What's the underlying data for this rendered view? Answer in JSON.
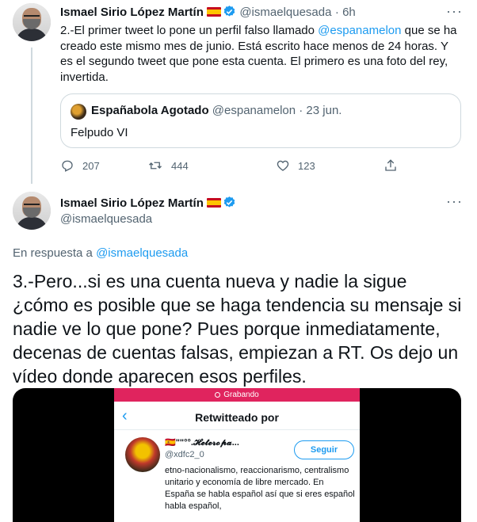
{
  "tweet1": {
    "name": "Ismael Sirio López Martín",
    "handle": "@ismaelquesada",
    "time": "· 6h",
    "text_before_mention": "2.-El primer tweet lo pone un perfil falso llamado ",
    "mention": "@espanamelon",
    "text_after_mention": " que se ha creado este mismo mes de junio. Está escrito hace menos de 24 horas. Y es el segundo tweet que pone esta cuenta. El primero es una foto del rey, invertida.",
    "quote": {
      "name": "Españabola Agotado",
      "handle": "@espanamelon",
      "time": "· 23 jun.",
      "text": "Felpudo VI"
    },
    "replies": "207",
    "retweets": "444",
    "likes": "123"
  },
  "tweet2": {
    "name": "Ismael Sirio López Martín",
    "handle": "@ismaelquesada",
    "reply_prefix": "En respuesta a ",
    "reply_mention": "@ismaelquesada",
    "text": "3.-Pero...si es una cuenta nueva y nadie la sigue ¿cómo es posible que se haga tendencia su mensaje si nadie ve lo que pone? Pues porque inmediatamente, decenas de cuentas falsas, empiezan a RT. Os dejo un vídeo donde aparecen esos perfiles."
  },
  "video": {
    "recording": "Grabando",
    "back": "‹",
    "title": "Retwitteado por",
    "user_name": "🇪🇸\"\"°°.𝓗𝓮𝓽𝓮𝓻𝓸𝓹𝓪...",
    "user_handle": "@xdfc2_0",
    "follow": "Seguir",
    "bio": "etno-nacionalismo, reaccionarismo, centralismo unitario y economía de libre mercado. En España se habla español así que si eres español habla español,"
  },
  "colors": {
    "accent": "#1d9bf0",
    "text": "#0f1419",
    "muted": "#536471",
    "border": "#cfd9de",
    "recording": "#e0245e"
  }
}
